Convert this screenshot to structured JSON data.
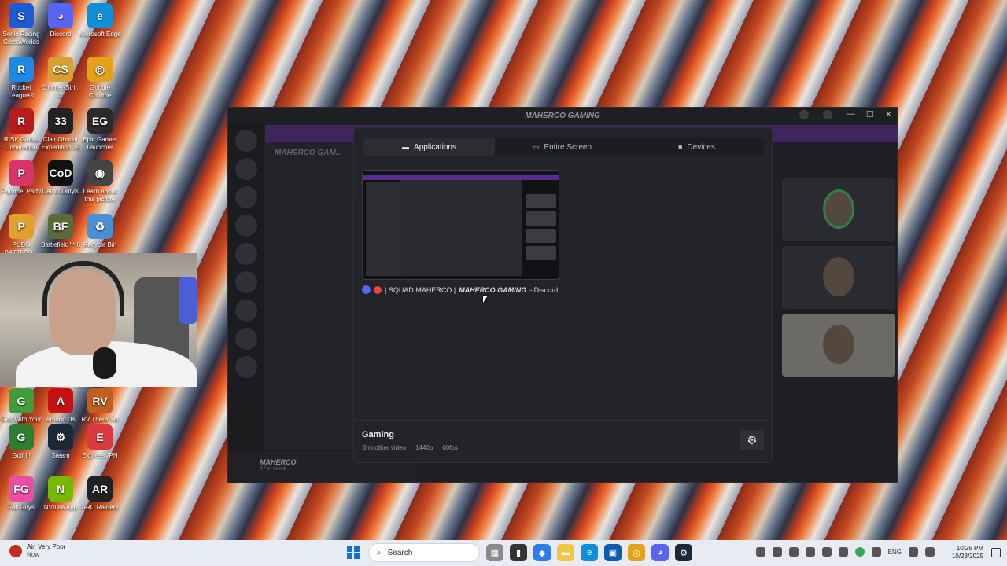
{
  "desktop": {
    "icons": [
      {
        "label": "Sonic Racing CrossWorlds",
        "color": "#1d5bd6",
        "glyph": "S"
      },
      {
        "label": "Discord",
        "color": "#5865f2",
        "glyph": "◕"
      },
      {
        "label": "Microsoft Edge",
        "color": "#0f8fd8",
        "glyph": "e"
      },
      {
        "label": "Rocket League®",
        "color": "#1e88e5",
        "glyph": "R"
      },
      {
        "label": "Counter-Stri... 2",
        "color": "#d8a030",
        "glyph": "CS"
      },
      {
        "label": "Google Chrome",
        "color": "#e3a21a",
        "glyph": "◎"
      },
      {
        "label": "RISK Global Domination",
        "color": "#b71c1c",
        "glyph": "R"
      },
      {
        "label": "Clair Obscur Expedition 33",
        "color": "#222222",
        "glyph": "33"
      },
      {
        "label": "Epic Games Launcher",
        "color": "#2a2a2a",
        "glyph": "EG"
      },
      {
        "label": "Pummel Party",
        "color": "#d8346a",
        "glyph": "P"
      },
      {
        "label": "Call of Duty®",
        "color": "#111111",
        "glyph": "CoD"
      },
      {
        "label": "Learn about this picture",
        "color": "#444444",
        "glyph": "◉"
      },
      {
        "label": "PUBG BATTLEG...",
        "color": "#e0a22c",
        "glyph": "P"
      },
      {
        "label": "Battlefield™ 6",
        "color": "#5a6b3a",
        "glyph": "BF"
      },
      {
        "label": "Recycle Bin",
        "color": "#4a8fd6",
        "glyph": "♻"
      },
      {
        "label": "Golf With Your Friends",
        "color": "#3f9d3a",
        "glyph": "G"
      },
      {
        "label": "Among Us",
        "color": "#c51111",
        "glyph": "A"
      },
      {
        "label": "RV There Yet",
        "color": "#c06020",
        "glyph": "RV"
      },
      {
        "label": "Golf It!",
        "color": "#2e7d32",
        "glyph": "G"
      },
      {
        "label": "Steam",
        "color": "#1b2838",
        "glyph": "⚙"
      },
      {
        "label": "ExpressVPN",
        "color": "#da3940",
        "glyph": "E"
      },
      {
        "label": "Fall Guys",
        "color": "#e84ea6",
        "glyph": "FG"
      },
      {
        "label": "NVIDIA App",
        "color": "#76b900",
        "glyph": "N"
      },
      {
        "label": "ARC Raiders",
        "color": "#222222",
        "glyph": "AR"
      }
    ]
  },
  "discord": {
    "window_title": "MAHERCO GAMING",
    "server_name": "MAHERCO GAM...",
    "user_name": "MAHERCO",
    "user_status": "47 in voice"
  },
  "modal": {
    "tabs": [
      {
        "label": "Applications",
        "icon": "window-icon",
        "active": true
      },
      {
        "label": "Entire Screen",
        "icon": "monitor-icon",
        "active": false
      },
      {
        "label": "Devices",
        "icon": "camera-icon",
        "active": false
      }
    ],
    "app_card": {
      "label_prefix": "| SQUAD MAHERCO |",
      "label_italic": "MAHERCO GAMING",
      "label_suffix": "- Discord"
    },
    "quality": {
      "title": "Gaming",
      "subtitle": "Smoother video",
      "resolution": "1440p",
      "fps": "60fps"
    }
  },
  "taskbar": {
    "weather_title": "Air: Very Poor",
    "weather_sub": "Now",
    "search_placeholder": "Search",
    "language": "ENG",
    "time": "10:25 PM",
    "date": "10/28/2025"
  }
}
